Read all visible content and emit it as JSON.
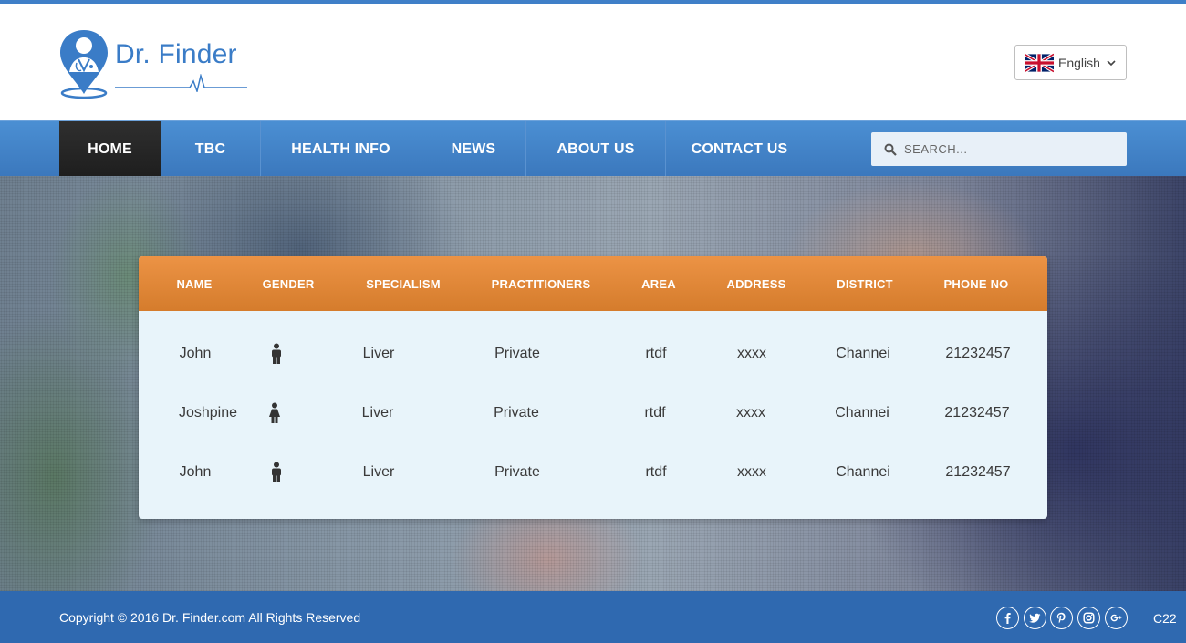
{
  "header": {
    "brand_name": "Dr. Finder",
    "language": {
      "label": "English",
      "flag_icon": "uk-flag-icon"
    }
  },
  "nav": {
    "items": [
      {
        "label": "HOME",
        "active": true
      },
      {
        "label": "TBC"
      },
      {
        "label": "HEALTH INFO"
      },
      {
        "label": "NEWS"
      },
      {
        "label": "ABOUT US"
      },
      {
        "label": "CONTACT US"
      }
    ],
    "search": {
      "placeholder": "SEARCH...",
      "icon": "search-icon"
    }
  },
  "table": {
    "columns": [
      "NAME",
      "GENDER",
      "SPECIALISM",
      "PRACTITIONERS",
      "AREA",
      "ADDRESS",
      "DISTRICT",
      "PHONE NO"
    ],
    "rows": [
      {
        "name": "John",
        "gender": "male",
        "specialism": "Liver",
        "practitioners": "Private",
        "area": "rtdf",
        "address": "xxxx",
        "district": "Channei",
        "phone": "21232457"
      },
      {
        "name": "Joshpine",
        "gender": "female",
        "specialism": "Liver",
        "practitioners": "Private",
        "area": "rtdf",
        "address": "xxxx",
        "district": "Channei",
        "phone": "21232457"
      },
      {
        "name": "John",
        "gender": "male",
        "specialism": "Liver",
        "practitioners": "Private",
        "area": "rtdf",
        "address": "xxxx",
        "district": "Channei",
        "phone": "21232457"
      }
    ]
  },
  "footer": {
    "copyright": "Copyright © 2016 Dr. Finder.com All Rights Reserved",
    "social": [
      "facebook-icon",
      "twitter-icon",
      "pinterest-icon",
      "instagram-icon",
      "google-plus-icon"
    ],
    "code": "C22"
  },
  "colors": {
    "accent_blue": "#3f7fc8",
    "nav_blue": "#4286cc",
    "active_nav": "#262626",
    "table_header_orange": "#e18a3a",
    "table_body": "#e8f4fa",
    "footer_blue": "#2f69b0"
  }
}
